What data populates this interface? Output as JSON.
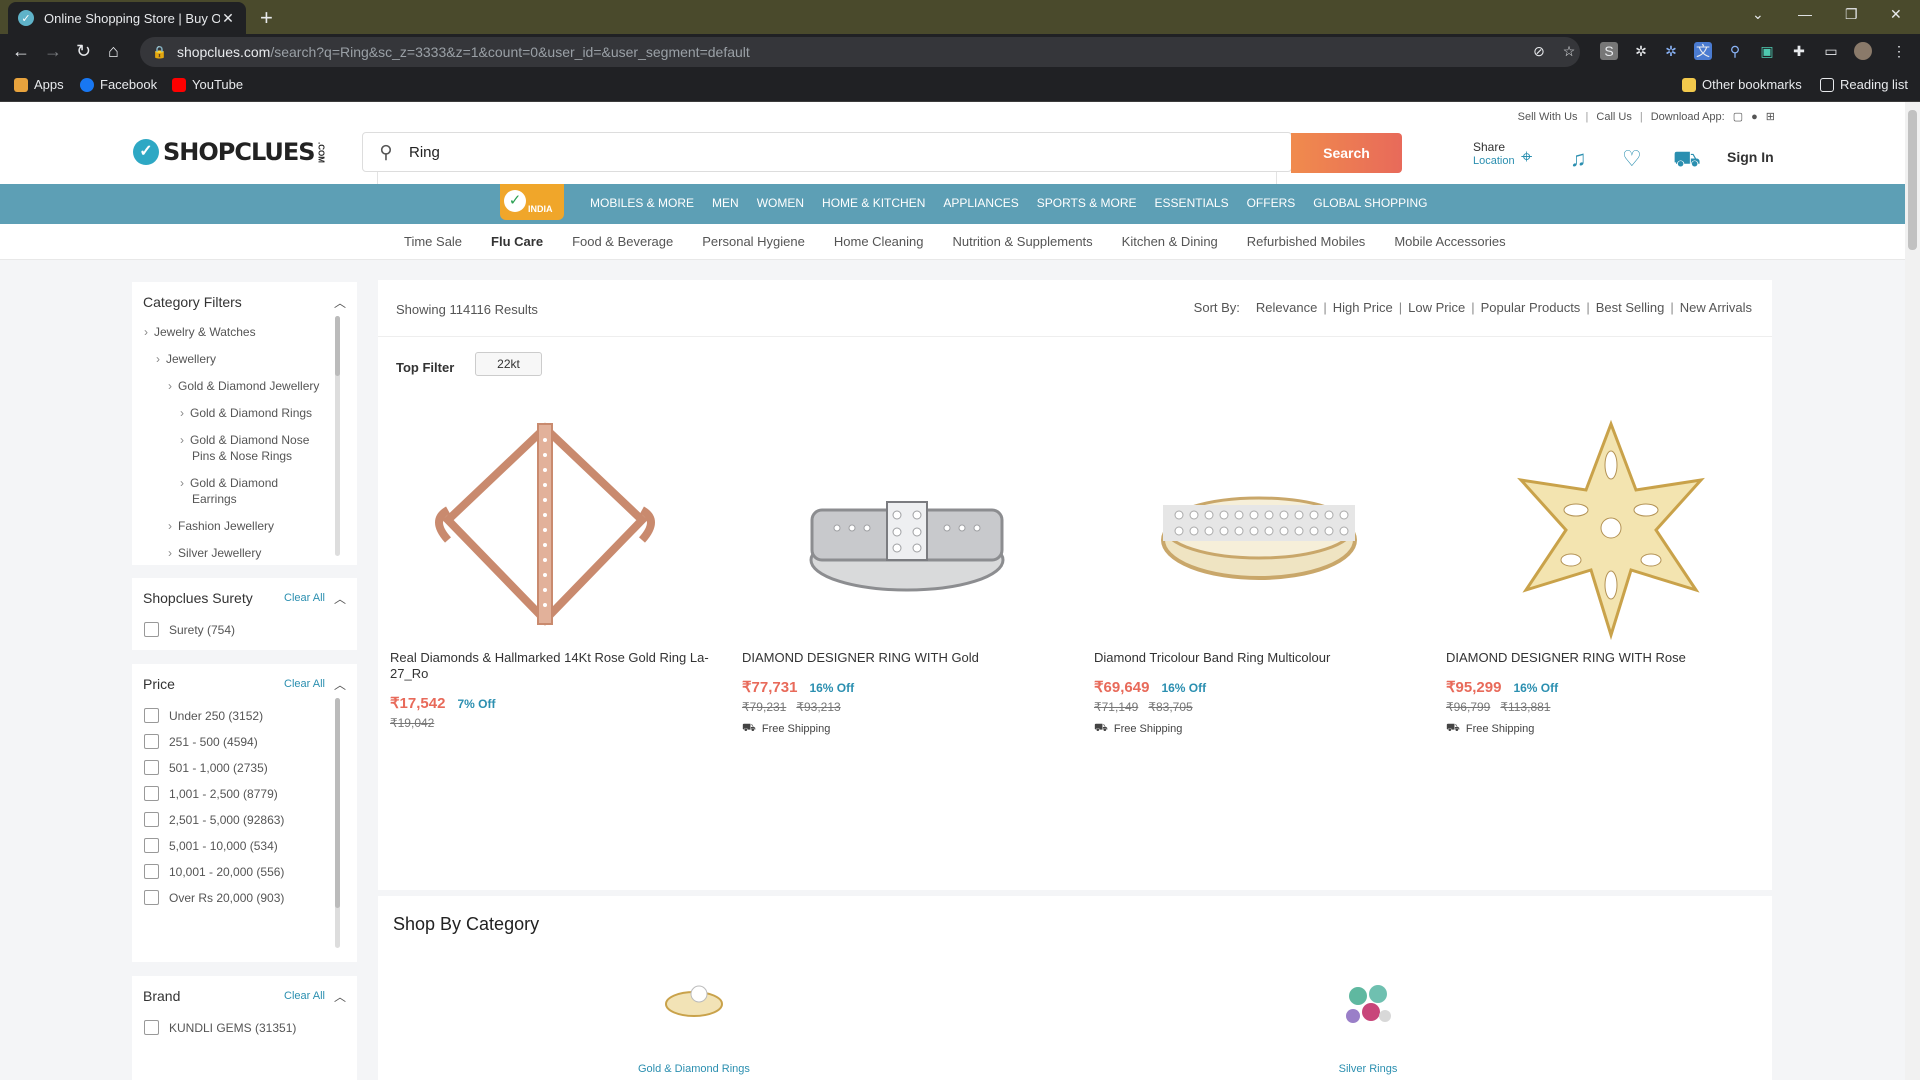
{
  "browser": {
    "tab_title": "Online Shopping Store | Buy Onli",
    "url_host": "shopclues.com",
    "url_path": "/search?q=Ring&sc_z=3333&z=1&count=0&user_id=&user_segment=default",
    "bookmarks": [
      {
        "label": "Apps",
        "color": "#e8a33d"
      },
      {
        "label": "Facebook",
        "color": "#1877f2"
      },
      {
        "label": "YouTube",
        "color": "#ff0000"
      }
    ],
    "other_bookmarks": "Other bookmarks",
    "reading_list": "Reading list"
  },
  "header": {
    "top_links": [
      "Sell With Us",
      "Call Us",
      "Download App:"
    ],
    "logo": "SHOPCLUES",
    "logo_suffix": ".COM",
    "search_value": "Ring",
    "search_button": "Search",
    "share_label": "Share",
    "location_label": "Location",
    "signin_label": "Sign In",
    "made_in": "INDIA"
  },
  "category_bar": [
    "MOBILES & MORE",
    "MEN",
    "WOMEN",
    "HOME & KITCHEN",
    "APPLIANCES",
    "SPORTS & MORE",
    "ESSENTIALS",
    "OFFERS",
    "GLOBAL SHOPPING"
  ],
  "sub_nav": [
    "Time Sale",
    "Flu Care",
    "Food & Beverage",
    "Personal Hygiene",
    "Home Cleaning",
    "Nutrition & Supplements",
    "Kitchen & Dining",
    "Refurbished Mobiles",
    "Mobile Accessories"
  ],
  "sidebar": {
    "category_filters": {
      "title": "Category Filters",
      "items": [
        "Jewelry & Watches",
        "Jewellery",
        "Gold & Diamond Jewellery",
        "Gold & Diamond Rings",
        "Gold & Diamond Nose",
        "Pins & Nose Rings",
        "Gold & Diamond",
        "Earrings",
        "Fashion Jewellery",
        "Silver Jewellery"
      ]
    },
    "surety": {
      "title": "Shopclues Surety",
      "clear": "Clear All",
      "options": [
        "Surety (754)"
      ]
    },
    "price": {
      "title": "Price",
      "clear": "Clear All",
      "options": [
        "Under 250 (3152)",
        "251 - 500 (4594)",
        "501 - 1,000 (2735)",
        "1,001 - 2,500 (8779)",
        "2,501 - 5,000 (92863)",
        "5,001 - 10,000 (534)",
        "10,001 - 20,000 (556)",
        "Over Rs 20,000 (903)"
      ]
    },
    "brand": {
      "title": "Brand",
      "clear": "Clear All",
      "options": [
        "KUNDLI GEMS (31351)"
      ]
    }
  },
  "results": {
    "showing_prefix": "Showing",
    "count": "114116",
    "showing_suffix": "Results",
    "sort_label": "Sort By:",
    "sort_options": [
      "Relevance",
      "High Price",
      "Low Price",
      "Popular Products",
      "Best Selling",
      "New Arrivals"
    ],
    "top_filter_label": "Top Filter",
    "top_filter_chip": "22kt"
  },
  "products": [
    {
      "name": "Real Diamonds & Hallmarked 14Kt Rose Gold Ring La-27_Ro",
      "price": "₹17,542",
      "off": "7% Off",
      "old": [
        "₹19,042"
      ],
      "shipping": ""
    },
    {
      "name": "DIAMOND DESIGNER RING WITH Gold",
      "price": "₹77,731",
      "off": "16% Off",
      "old": [
        "₹79,231",
        "₹93,213"
      ],
      "shipping": "Free Shipping"
    },
    {
      "name": "Diamond Tricolour Band Ring Multicolour",
      "price": "₹69,649",
      "off": "16% Off",
      "old": [
        "₹71,149",
        "₹83,705"
      ],
      "shipping": "Free Shipping"
    },
    {
      "name": "DIAMOND DESIGNER RING WITH Rose",
      "price": "₹95,299",
      "off": "16% Off",
      "old": [
        "₹96,799",
        "₹113,881"
      ],
      "shipping": "Free Shipping"
    }
  ],
  "shop_by_category": {
    "title": "Shop By Category",
    "items": [
      "Gold & Diamond Rings",
      "Silver Rings"
    ]
  }
}
